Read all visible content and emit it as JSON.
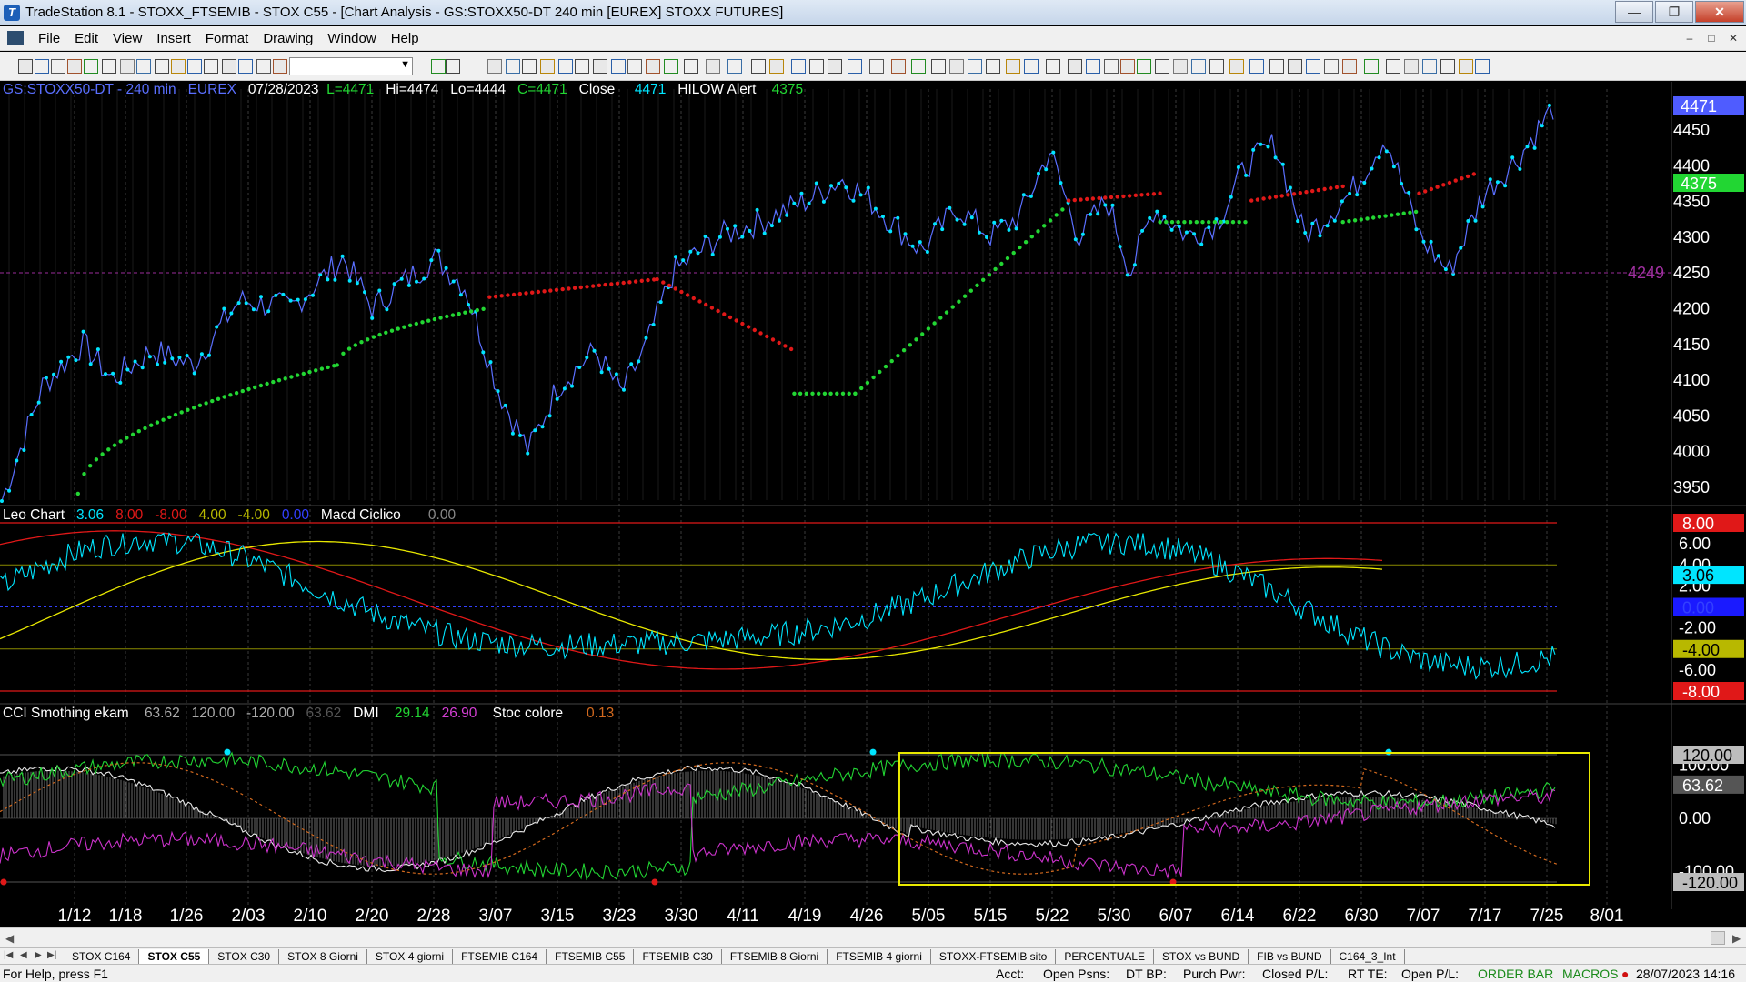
{
  "window": {
    "title": "TradeStation 8.1 - STOXX_FTSEMIB - STOX C55 - [Chart Analysis - GS:STOXX50-DT  240 min  [EUREX] STOXX FUTURES]"
  },
  "menu": [
    "File",
    "Edit",
    "View",
    "Insert",
    "Format",
    "Drawing",
    "Window",
    "Help"
  ],
  "status_price": {
    "symbol": "GS:STOXX50-DT - 240 min",
    "exchange": "EUREX",
    "date": "07/28/2023",
    "last": "L=4471",
    "high": "Hi=4474",
    "low": "Lo=4444",
    "close_val": "C=4471",
    "close_label": "Close",
    "close_num": "4471",
    "alert_label": "HILOW Alert",
    "alert_val": "4375"
  },
  "status_osc": {
    "name": "Leo Chart",
    "v1": "3.06",
    "v2": "8.00",
    "v3": "-8.00",
    "v4": "4.00",
    "v5": "-4.00",
    "v6": "0.00",
    "macd_name": "Macd Ciclico",
    "macd_val": "0.00"
  },
  "status_cci": {
    "name": "CCI Smothing ekam",
    "v1": "63.62",
    "v2": "120.00",
    "v3": "-120.00",
    "v4": "63.62",
    "dmi_name": "DMI",
    "dmi1": "29.14",
    "dmi2": "26.90",
    "stoc_name": "Stoc colore",
    "stoc_val": "0.13"
  },
  "price_axis": [
    "4450",
    "4400",
    "4350",
    "4300",
    "4250",
    "4200",
    "4150",
    "4100",
    "4050",
    "4000",
    "3950"
  ],
  "price_tags": {
    "last": "4471",
    "alert": "4375",
    "line": "4249"
  },
  "osc_axis": [
    "6.00",
    "4.00",
    "2.00",
    "-2.00",
    "-6.00"
  ],
  "osc_tags": {
    "top": "8.00",
    "v": "3.06",
    "zero": "0.00",
    "neg4": "-4.00",
    "bot": "-8.00"
  },
  "cci_axis": [
    "100.00",
    "0.00",
    "-100.00"
  ],
  "cci_tags": {
    "top": "120.00",
    "v": "63.62",
    "bot": "-120.00"
  },
  "dates": [
    "1/12",
    "1/18",
    "1/26",
    "2/03",
    "2/10",
    "2/20",
    "2/28",
    "3/07",
    "3/15",
    "3/23",
    "3/30",
    "4/11",
    "4/19",
    "4/26",
    "5/05",
    "5/15",
    "5/22",
    "5/30",
    "6/07",
    "6/14",
    "6/22",
    "6/30",
    "7/07",
    "7/17",
    "7/25",
    "8/01"
  ],
  "tabs": [
    "STOX C164",
    "STOX C55",
    "STOX  C30",
    "STOX  8 Giorni",
    "STOX 4 giorni",
    "FTSEMIB C164",
    "FTSEMIB C55",
    "FTSEMIB C30",
    "FTSEMIB  8 Giorni",
    "FTSEMIB  4 giorni",
    "STOXX-FTSEMIB sito",
    "PERCENTUALE",
    "STOX vs BUND",
    "FIB vs BUND",
    "C164_3_Int"
  ],
  "active_tab": "STOX C55",
  "statusbar": {
    "help": "For Help, press F1",
    "acct": "Acct:",
    "open_psns": "Open Psns:",
    "dt_bp": "DT BP:",
    "purch_pwr": "Purch Pwr:",
    "closed_pl": "Closed P/L:",
    "rt_te": "RT TE:",
    "open_pl": "Open P/L:",
    "order_bar": "ORDER BAR",
    "macros": "MACROS",
    "datetime": "28/07/2023 14:16"
  },
  "colors": {
    "cyan": "#00e5ff",
    "green": "#22d633",
    "red": "#e01818",
    "yellow": "#e8e800",
    "magenta": "#cc33cc",
    "orange": "#d2691e",
    "blue_line": "#5a6fff"
  }
}
